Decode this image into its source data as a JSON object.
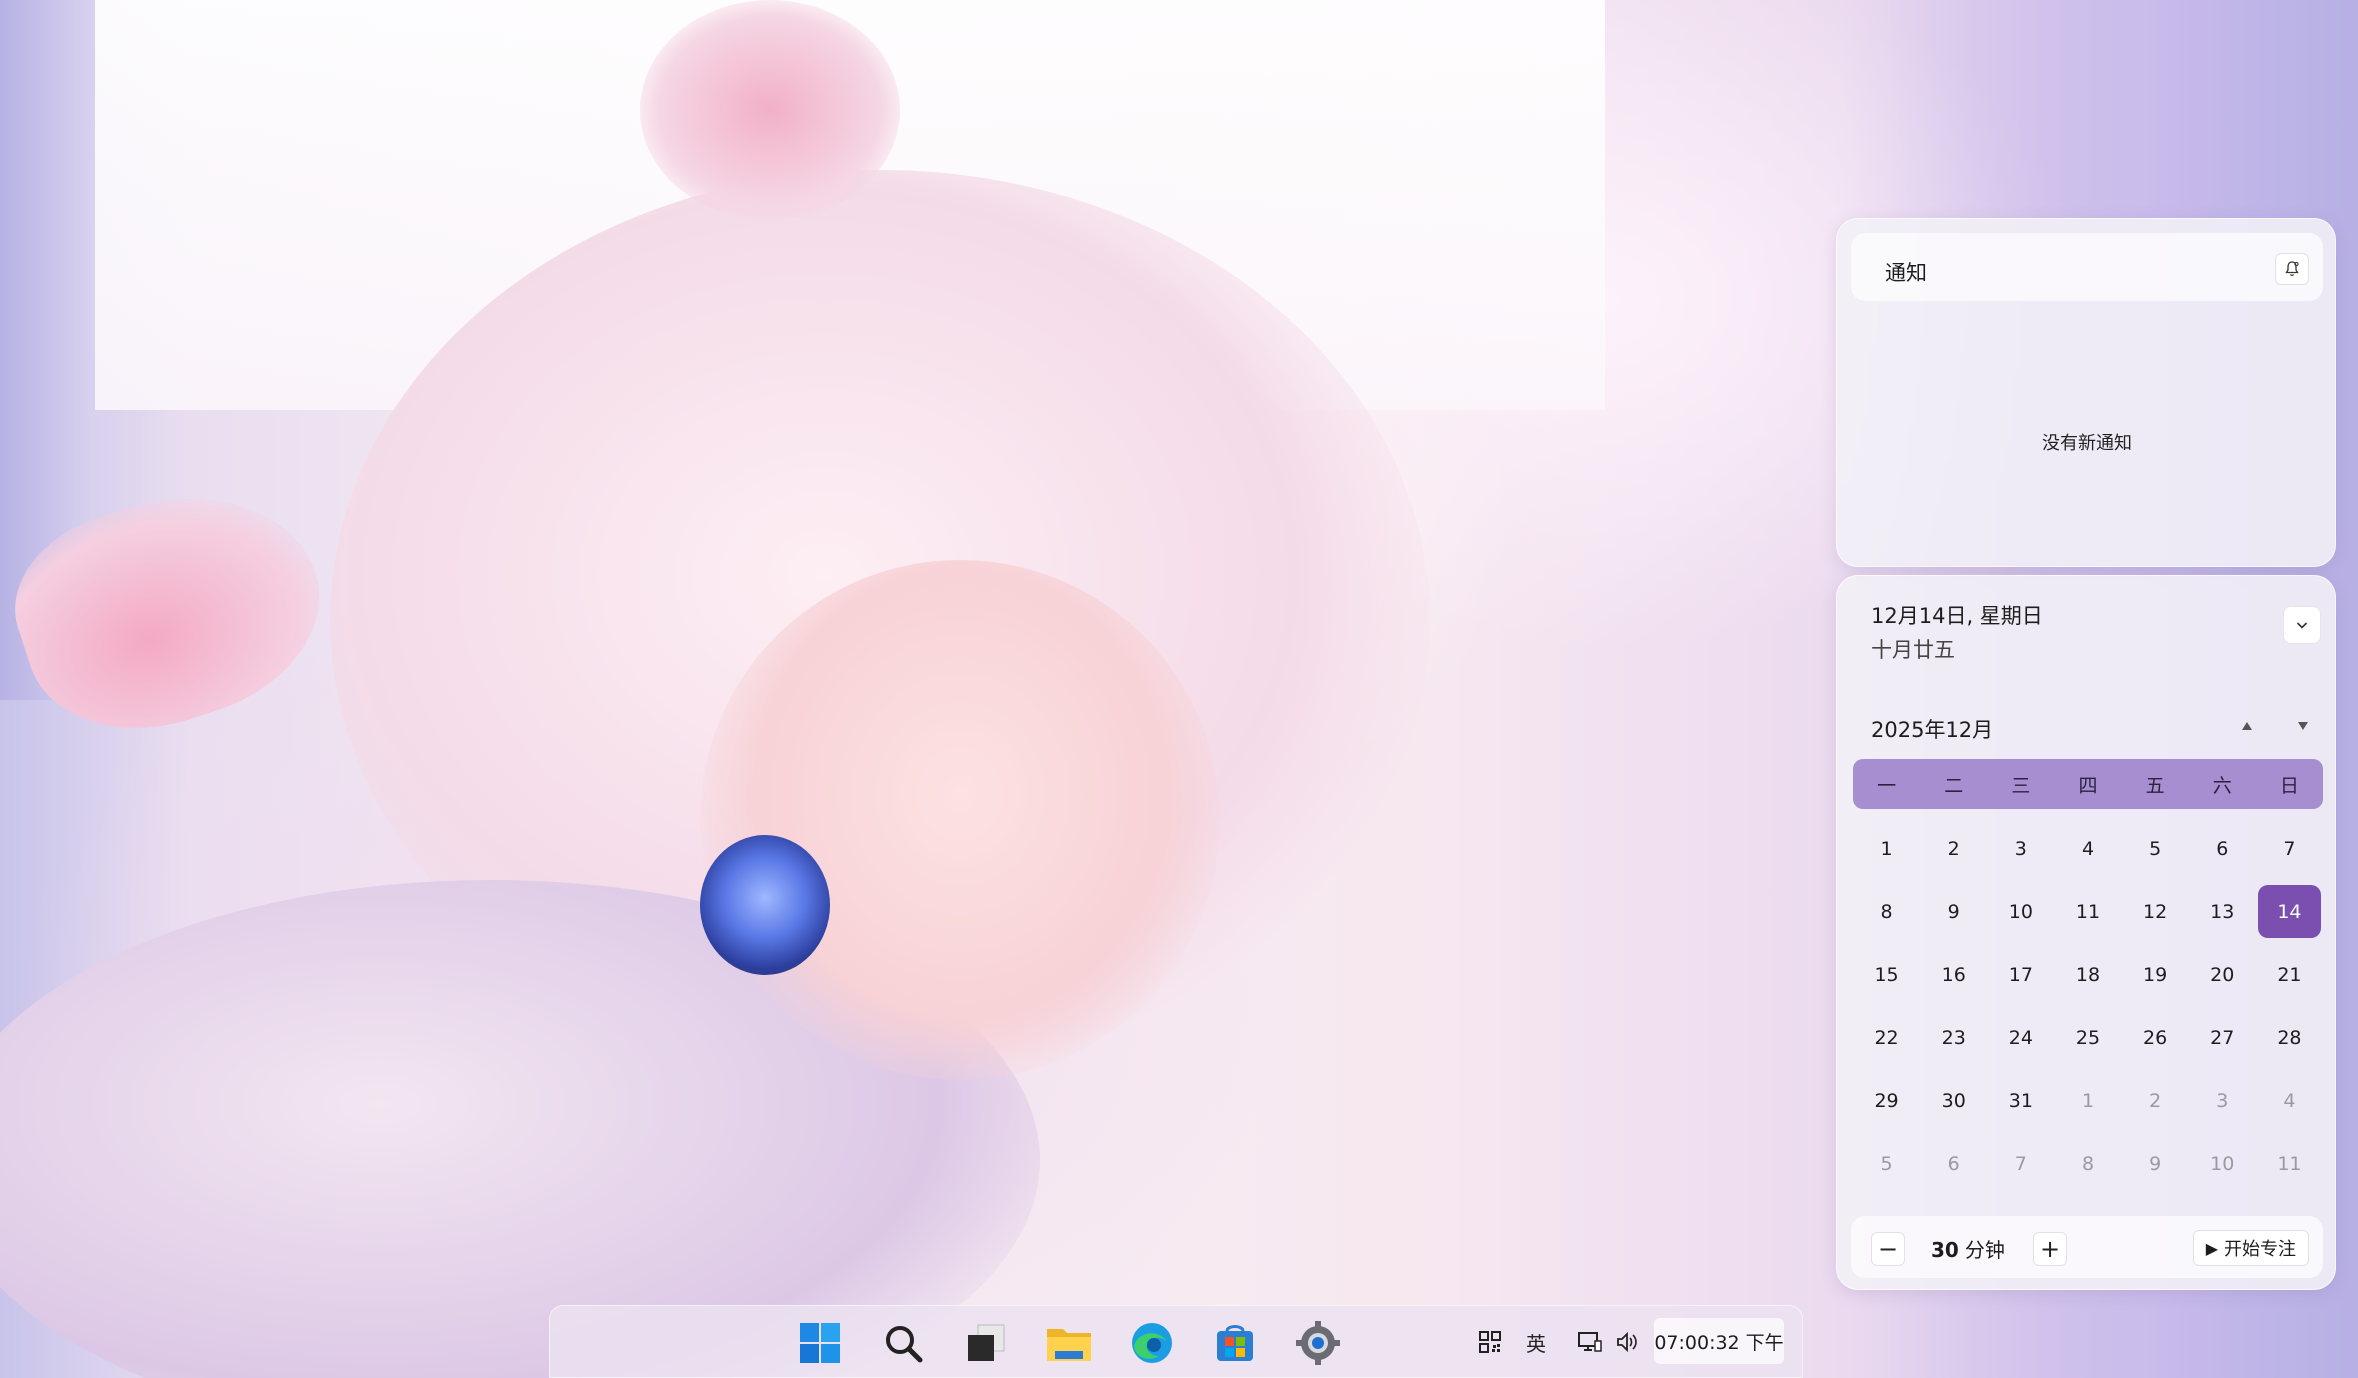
{
  "notifications": {
    "title": "通知",
    "empty_text": "没有新通知"
  },
  "calendar": {
    "date_label": "12月14日, 星期日",
    "lunar_label": "十月廿五",
    "month_label": "2025年12月",
    "weekdays": [
      "一",
      "二",
      "三",
      "四",
      "五",
      "六",
      "日"
    ],
    "days": [
      {
        "n": "1",
        "other": false
      },
      {
        "n": "2",
        "other": false
      },
      {
        "n": "3",
        "other": false
      },
      {
        "n": "4",
        "other": false
      },
      {
        "n": "5",
        "other": false
      },
      {
        "n": "6",
        "other": false
      },
      {
        "n": "7",
        "other": false
      },
      {
        "n": "8",
        "other": false
      },
      {
        "n": "9",
        "other": false
      },
      {
        "n": "10",
        "other": false
      },
      {
        "n": "11",
        "other": false
      },
      {
        "n": "12",
        "other": false
      },
      {
        "n": "13",
        "other": false
      },
      {
        "n": "14",
        "other": false,
        "today": true
      },
      {
        "n": "15",
        "other": false
      },
      {
        "n": "16",
        "other": false
      },
      {
        "n": "17",
        "other": false
      },
      {
        "n": "18",
        "other": false
      },
      {
        "n": "19",
        "other": false
      },
      {
        "n": "20",
        "other": false
      },
      {
        "n": "21",
        "other": false
      },
      {
        "n": "22",
        "other": false
      },
      {
        "n": "23",
        "other": false
      },
      {
        "n": "24",
        "other": false
      },
      {
        "n": "25",
        "other": false
      },
      {
        "n": "26",
        "other": false
      },
      {
        "n": "27",
        "other": false
      },
      {
        "n": "28",
        "other": false
      },
      {
        "n": "29",
        "other": false
      },
      {
        "n": "30",
        "other": false
      },
      {
        "n": "31",
        "other": false
      },
      {
        "n": "1",
        "other": true
      },
      {
        "n": "2",
        "other": true
      },
      {
        "n": "3",
        "other": true
      },
      {
        "n": "4",
        "other": true
      },
      {
        "n": "5",
        "other": true
      },
      {
        "n": "6",
        "other": true
      },
      {
        "n": "7",
        "other": true
      },
      {
        "n": "8",
        "other": true
      },
      {
        "n": "9",
        "other": true
      },
      {
        "n": "10",
        "other": true
      },
      {
        "n": "11",
        "other": true
      }
    ]
  },
  "focus": {
    "minus_label": "−",
    "plus_label": "+",
    "minutes_value": "30",
    "minutes_unit": "分钟",
    "start_label": "开始专注"
  },
  "taskbar": {
    "apps": [
      "start-icon",
      "search-icon",
      "task-view-icon",
      "file-explorer-icon",
      "edge-icon",
      "store-icon",
      "settings-icon"
    ],
    "ime_label": "英",
    "clock_label": "07:00:32 下午"
  },
  "colors": {
    "accent": "#7a4fb0",
    "weekday_bar": "#a68ed1"
  }
}
